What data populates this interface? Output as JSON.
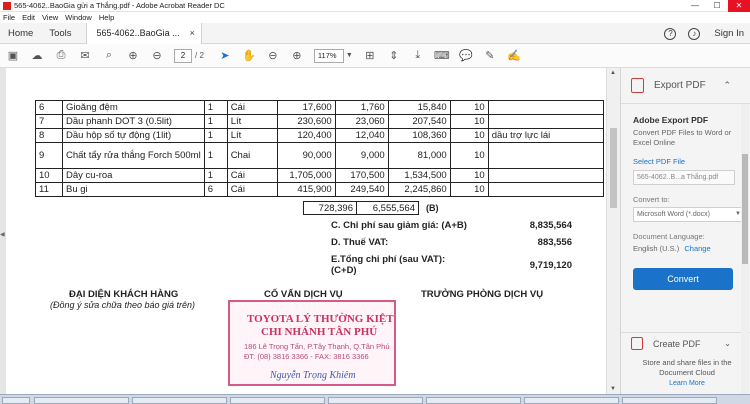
{
  "window": {
    "title": "565-4062..BaoGia gửi a Thắng.pdf - Adobe Acrobat Reader DC",
    "controls": [
      "—",
      "☐",
      "✕"
    ]
  },
  "menu": [
    "File",
    "Edit",
    "View",
    "Window",
    "Help"
  ],
  "tabs": {
    "home": "Home",
    "tools": "Tools",
    "document": "565-4062..BaoGia ...",
    "document_close": "×",
    "help": "?",
    "sign_in": "Sign In"
  },
  "toolbar": {
    "page_current": "2",
    "page_sep": "/ 2",
    "zoom": "117%"
  },
  "items_table": {
    "rows": [
      {
        "no": "6",
        "name": "Gioăng đệm",
        "qty": "1",
        "unit": "Cái",
        "price": "17,600",
        "discount": "1,760",
        "amount": "15,840",
        "vat": "10",
        "note": ""
      },
      {
        "no": "7",
        "name": "Dầu phanh DOT 3 (0.5lit)",
        "qty": "1",
        "unit": "Lít",
        "price": "230,600",
        "discount": "23,060",
        "amount": "207,540",
        "vat": "10",
        "note": ""
      },
      {
        "no": "8",
        "name": "Dầu hộp số tự động (1lit)",
        "qty": "1",
        "unit": "Lít",
        "price": "120,400",
        "discount": "12,040",
        "amount": "108,360",
        "vat": "10",
        "note": "dầu trợ lực lái"
      },
      {
        "no": "9",
        "name": "Chất tẩy rửa thắng Forch 500ml",
        "qty": "1",
        "unit": "Chai",
        "price": "90,000",
        "discount": "9,000",
        "amount": "81,000",
        "vat": "10",
        "note": ""
      },
      {
        "no": "10",
        "name": "Dây cu-roa",
        "qty": "1",
        "unit": "Cái",
        "price": "1,705,000",
        "discount": "170,500",
        "amount": "1,534,500",
        "vat": "10",
        "note": ""
      },
      {
        "no": "11",
        "name": "Bu gi",
        "qty": "6",
        "unit": "Cái",
        "price": "415,900",
        "discount": "249,540",
        "amount": "2,245,860",
        "vat": "10",
        "note": ""
      }
    ],
    "total_discount": "728,396",
    "total_amount": "6,555,564",
    "total_mark": "(B)"
  },
  "summary": {
    "c_label": "C. Chi phí sau giảm giá: (A+B)",
    "c_value": "8,835,564",
    "d_label": "D. Thuế VAT:",
    "d_value": "883,556",
    "e_label_1": "E.Tổng chi phí (sau VAT):",
    "e_label_2": "(C+D)",
    "e_value": "9,719,120"
  },
  "signatures": {
    "customer": "ĐẠI DIỆN KHÁCH HÀNG",
    "customer_note": "(Đồng ý sửa chữa theo báo giá trên)",
    "advisor": "CỐ VẤN DỊCH VỤ",
    "manager": "TRƯỞNG PHÒNG DỊCH VỤ"
  },
  "stamp": {
    "line1": "TOYOTA LÝ THƯỜNG KIỆT",
    "line2": "CHI NHÁNH TÂN PHÚ",
    "line3": "186 Lê Trọng Tấn, P.Tây Thạnh, Q.Tân Phú",
    "line4": "ĐT: (08) 3816 3366 - FAX: 3816 3366",
    "line5": "Nguyễn Trọng Khiêm"
  },
  "right_panel": {
    "header": "Export PDF",
    "section_title": "Adobe Export PDF",
    "description": "Convert PDF Files to Word or Excel Online",
    "select_link": "Select PDF File",
    "file_name": "565-4062..B...a Thắng.pdf",
    "convert_to_label": "Convert to:",
    "convert_to_value": "Microsoft Word (*.docx)",
    "language_label": "Document Language:",
    "language_value": "English (U.S.)",
    "language_change": "Change",
    "convert_button": "Convert",
    "create_pdf": "Create PDF",
    "store_text": "Store and share files in the Document Cloud",
    "learn_more": "Learn More"
  },
  "colors": {
    "accent": "#1a73c8",
    "stamp": "#cc3060"
  }
}
